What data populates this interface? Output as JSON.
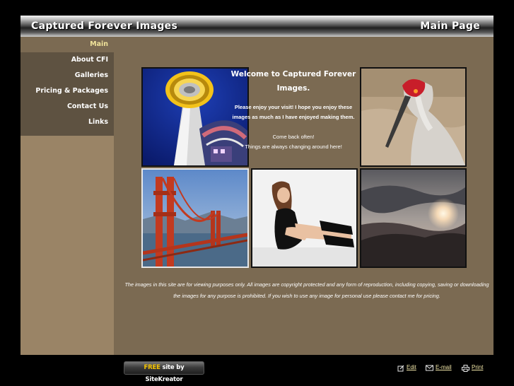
{
  "header": {
    "site_title": "Captured Forever Images",
    "page_title": "Main Page"
  },
  "nav": {
    "items": [
      {
        "label": "Main",
        "active": true
      },
      {
        "label": "About CFI",
        "active": false
      },
      {
        "label": "Galleries",
        "active": false
      },
      {
        "label": "Pricing & Packages",
        "active": false
      },
      {
        "label": "Contact Us",
        "active": false
      },
      {
        "label": "Links",
        "active": false
      }
    ]
  },
  "welcome": {
    "title": "Welcome to Captured Forever Images.",
    "intro": "Please enjoy your visit! I hope you enjoy these images as much as I have enjoyed making them.",
    "come_back": "Come back often!",
    "changing": "Things are always changing around here!"
  },
  "photos": [
    {
      "name": "space-needle-photo"
    },
    {
      "name": "sandhill-crane-photo"
    },
    {
      "name": "golden-gate-bridge-photo"
    },
    {
      "name": "model-portrait-photo"
    },
    {
      "name": "mountain-sunset-photo"
    }
  ],
  "disclaimer": "The images in this site are for viewing purposes only. All images are copyright protected and any form of reproduction, including copying, saving or downloading the images for any purpose is prohibited. If you wish to use any image for personal use please contact me for pricing.",
  "footer": {
    "badge_free": "FREE",
    "badge_rest": " site by SiteKreator",
    "edit_label": "Edit",
    "email_label": "E-mail",
    "print_label": "Print",
    "edit_icon": "edit-icon",
    "email_icon": "envelope-icon",
    "print_icon": "printer-icon"
  },
  "colors": {
    "background": "#000000",
    "content": "#7b6a52",
    "sidebar": "#9a8466",
    "nav": "#5e5241",
    "active_nav_text": "#f0e39a",
    "footer_link": "#f1e6a8",
    "badge_accent": "#f5c400"
  }
}
